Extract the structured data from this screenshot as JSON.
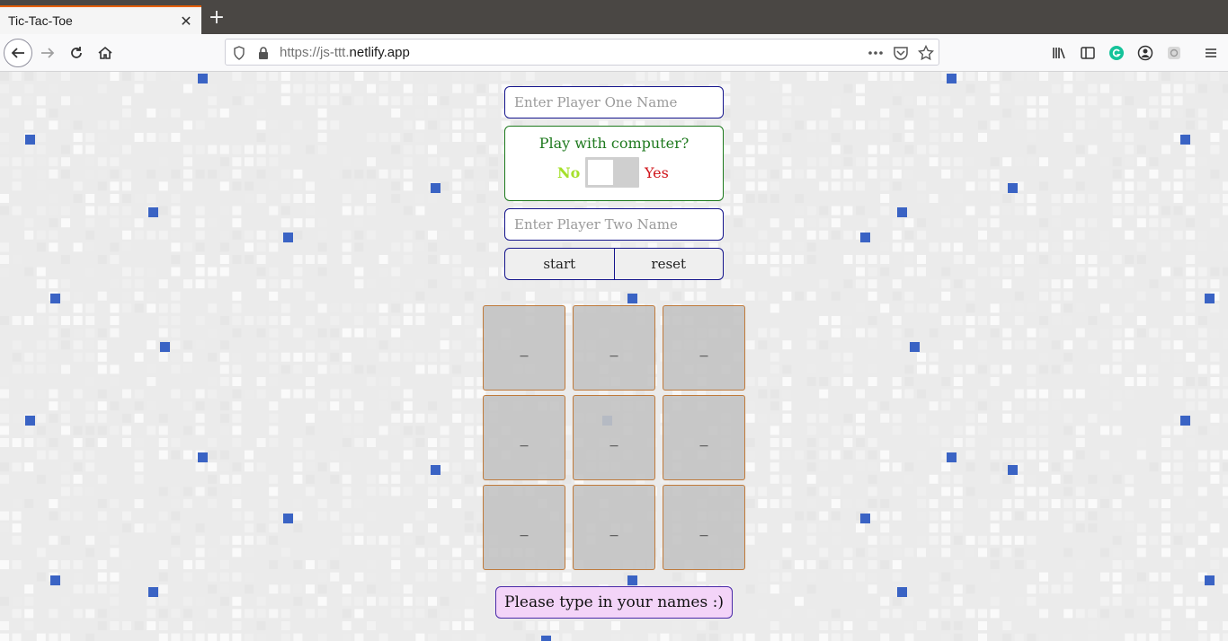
{
  "browser": {
    "tab_title": "Tic-Tac-Toe",
    "url_prefix": "https://js-ttt.",
    "url_domain": "netlify.app"
  },
  "form": {
    "player_one_placeholder": "Enter Player One Name",
    "player_two_placeholder": "Enter Player Two Name",
    "computer_question": "Play with computer?",
    "computer_no": "No",
    "computer_yes": "Yes",
    "start_label": "start",
    "reset_label": "reset"
  },
  "board": {
    "cells": [
      "_",
      "_",
      "_",
      "_",
      "_",
      "_",
      "_",
      "_",
      "_"
    ]
  },
  "status": {
    "message": "Please type in your names :)"
  },
  "colors": {
    "accent_blue": "#3a63c4",
    "toggle_no": "#a5e02a",
    "toggle_yes": "#d0141a"
  }
}
